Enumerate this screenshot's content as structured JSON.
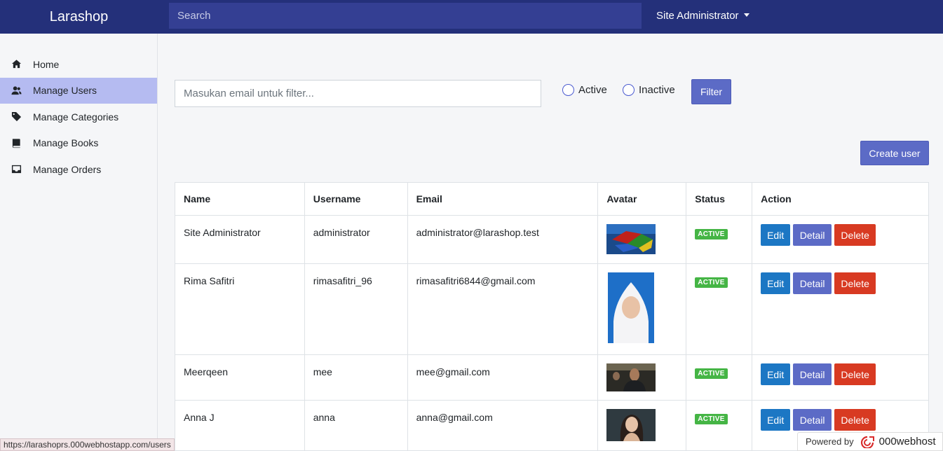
{
  "navbar": {
    "brand": "Larashop",
    "search_placeholder": "Search",
    "user_name": "Site Administrator"
  },
  "sidebar": {
    "items": [
      {
        "label": "Home",
        "icon": "home-icon"
      },
      {
        "label": "Manage Users",
        "icon": "users-icon",
        "active": true
      },
      {
        "label": "Manage Categories",
        "icon": "tag-icon"
      },
      {
        "label": "Manage Books",
        "icon": "book-icon"
      },
      {
        "label": "Manage Orders",
        "icon": "inbox-icon"
      }
    ]
  },
  "filter": {
    "email_placeholder": "Masukan email untuk filter...",
    "radio_active": "Active",
    "radio_inactive": "Inactive",
    "filter_label": "Filter"
  },
  "create_user_label": "Create user",
  "table": {
    "headers": [
      "Name",
      "Username",
      "Email",
      "Avatar",
      "Status",
      "Action"
    ],
    "rows": [
      {
        "name": "Site Administrator",
        "username": "administrator",
        "email": "administrator@larashop.test",
        "status": "ACTIVE"
      },
      {
        "name": "Rima Safitri",
        "username": "rimasafitri_96",
        "email": "rimasafitri6844@gmail.com",
        "status": "ACTIVE"
      },
      {
        "name": "Meerqeen",
        "username": "mee",
        "email": "mee@gmail.com",
        "status": "ACTIVE"
      },
      {
        "name": "Anna J",
        "username": "anna",
        "email": "anna@gmail.com",
        "status": "ACTIVE"
      }
    ],
    "action_labels": {
      "edit": "Edit",
      "detail": "Detail",
      "delete": "Delete"
    }
  },
  "statusbar_url": "https://larashoprs.000webhostapp.com/users",
  "powered": {
    "text": "Powered by",
    "host": "000webhost"
  },
  "colors": {
    "navbar": "#24307a",
    "active_nav": "#b5bbf1",
    "primary": "#5c6bc6",
    "edit": "#1c77c4",
    "delete": "#d83a22",
    "badge": "#45b545"
  }
}
